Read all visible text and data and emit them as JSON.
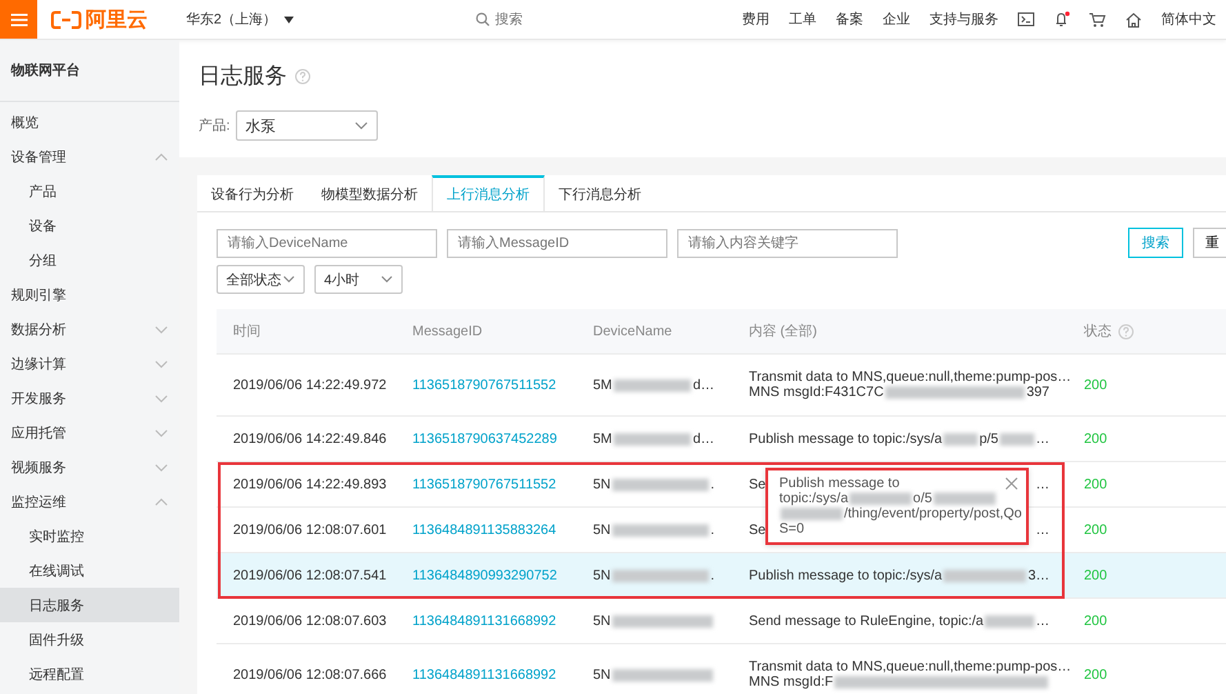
{
  "topbar": {
    "logo": "阿里云",
    "region": "华东2（上海）",
    "search_placeholder": "搜索",
    "links": [
      "费用",
      "工单",
      "备案",
      "企业",
      "支持与服务"
    ],
    "notification_dot": true,
    "language": "简体中文"
  },
  "sidebar": {
    "title": "物联网平台",
    "items": [
      {
        "label": "概览",
        "selected": false
      },
      {
        "label": "设备管理",
        "selected": false,
        "expanded": true,
        "children": [
          {
            "label": "产品",
            "selected": false
          },
          {
            "label": "设备",
            "selected": false
          },
          {
            "label": "分组",
            "selected": false
          }
        ]
      },
      {
        "label": "规则引擎",
        "selected": false
      },
      {
        "label": "数据分析",
        "selected": false,
        "expanded": false
      },
      {
        "label": "边缘计算",
        "selected": false,
        "expanded": false
      },
      {
        "label": "开发服务",
        "selected": false,
        "expanded": false
      },
      {
        "label": "应用托管",
        "selected": false,
        "expanded": false
      },
      {
        "label": "视频服务",
        "selected": false,
        "expanded": false
      },
      {
        "label": "监控运维",
        "selected": false,
        "expanded": true,
        "children": [
          {
            "label": "实时监控",
            "selected": false
          },
          {
            "label": "在线调试",
            "selected": false
          },
          {
            "label": "日志服务",
            "selected": true
          },
          {
            "label": "固件升级",
            "selected": false
          },
          {
            "label": "远程配置",
            "selected": false
          }
        ]
      }
    ]
  },
  "page": {
    "title": "日志服务",
    "product_label": "产品:",
    "product_value": "水泵"
  },
  "tabs": [
    {
      "label": "设备行为分析",
      "selected": false
    },
    {
      "label": "物模型数据分析",
      "selected": false
    },
    {
      "label": "上行消息分析",
      "selected": true
    },
    {
      "label": "下行消息分析",
      "selected": false
    }
  ],
  "filters": {
    "device_placeholder": "请输入DeviceName",
    "message_placeholder": "请输入MessageID",
    "keyword_placeholder": "请输入内容关键字",
    "status": "全部状态",
    "range": "4小时",
    "search_button": "搜索",
    "reset_button": "重"
  },
  "table": {
    "columns": [
      "时间",
      "MessageID",
      "DeviceName",
      "内容 (全部)",
      "状态"
    ],
    "rows": [
      {
        "time": "2019/06/06 14:22:49.972",
        "message_id": "1136518790767511552",
        "device": [
          {
            "kind": "text",
            "text": "5M"
          },
          {
            "kind": "redacted"
          },
          {
            "kind": "text",
            "text": "d…"
          }
        ],
        "content": [
          [
            {
              "kind": "text",
              "text": "Transmit data to MNS,queue:null,theme:pump-pos…"
            }
          ],
          [
            {
              "kind": "text",
              "text": "MNS msgId:F431C7C"
            },
            {
              "kind": "redacted"
            },
            {
              "kind": "text",
              "text": "397"
            }
          ]
        ],
        "status": "200",
        "selected": false,
        "highlighted": false
      },
      {
        "time": "2019/06/06 14:22:49.846",
        "message_id": "1136518790637452289",
        "device": [
          {
            "kind": "text",
            "text": "5M"
          },
          {
            "kind": "redacted"
          },
          {
            "kind": "text",
            "text": "d…"
          }
        ],
        "content": [
          [
            {
              "kind": "text",
              "text": "Publish message to topic:/sys/a"
            },
            {
              "kind": "redacted"
            },
            {
              "kind": "text",
              "text": "p/5"
            },
            {
              "kind": "redacted"
            },
            {
              "kind": "text",
              "text": "…"
            }
          ]
        ],
        "status": "200",
        "selected": false,
        "highlighted": false
      },
      {
        "time": "2019/06/06 14:22:49.893",
        "message_id": "1136518790767511552",
        "device": [
          {
            "kind": "text",
            "text": "5N"
          },
          {
            "kind": "redacted"
          },
          {
            "kind": "text",
            "text": "."
          }
        ],
        "content": [
          [
            {
              "kind": "text",
              "text": "Se"
            },
            {
              "kind": "text",
              "text": "…"
            }
          ]
        ],
        "status": "200",
        "selected": false,
        "highlighted": true
      },
      {
        "time": "2019/06/06 12:08:07.601",
        "message_id": "1136484891135883264",
        "device": [
          {
            "kind": "text",
            "text": "5N"
          },
          {
            "kind": "redacted"
          },
          {
            "kind": "text",
            "text": "."
          }
        ],
        "content": [
          [
            {
              "kind": "text",
              "text": "Se"
            },
            {
              "kind": "text",
              "text": "…"
            }
          ]
        ],
        "status": "200",
        "selected": false,
        "highlighted": true
      },
      {
        "time": "2019/06/06 12:08:07.541",
        "message_id": "1136484890993290752",
        "device": [
          {
            "kind": "text",
            "text": "5N"
          },
          {
            "kind": "redacted"
          },
          {
            "kind": "text",
            "text": "."
          }
        ],
        "content": [
          [
            {
              "kind": "text",
              "text": "Publish message to topic:/sys/a"
            },
            {
              "kind": "redacted"
            },
            {
              "kind": "text",
              "text": "3…"
            }
          ]
        ],
        "status": "200",
        "selected": true,
        "highlighted": true
      },
      {
        "time": "2019/06/06 12:08:07.603",
        "message_id": "1136484891131668992",
        "device": [
          {
            "kind": "text",
            "text": "5N"
          },
          {
            "kind": "redacted"
          }
        ],
        "content": [
          [
            {
              "kind": "text",
              "text": "Send message to RuleEngine, topic:/a"
            },
            {
              "kind": "redacted"
            },
            {
              "kind": "text",
              "text": "…"
            }
          ]
        ],
        "status": "200",
        "selected": false,
        "highlighted": false
      },
      {
        "time": "2019/06/06 12:08:07.666",
        "message_id": "1136484891131668992",
        "device": [
          {
            "kind": "text",
            "text": "5N"
          },
          {
            "kind": "redacted"
          }
        ],
        "content": [
          [
            {
              "kind": "text",
              "text": "Transmit data to MNS,queue:null,theme:pump-pos…"
            }
          ],
          [
            {
              "kind": "text",
              "text": "MNS msgId:F"
            },
            {
              "kind": "redacted"
            }
          ]
        ],
        "status": "200",
        "selected": false,
        "highlighted": false
      }
    ]
  },
  "tooltip": {
    "outlined": true,
    "lines": [
      [
        {
          "kind": "text",
          "text": "Publish message to"
        }
      ],
      [
        {
          "kind": "text",
          "text": "topic:/sys/a"
        },
        {
          "kind": "redacted"
        },
        {
          "kind": "text",
          "text": "o/5"
        },
        {
          "kind": "redacted"
        }
      ],
      [
        {
          "kind": "redacted"
        },
        {
          "kind": "text",
          "text": "/thing/event/property/post,Qo"
        }
      ],
      [
        {
          "kind": "text",
          "text": "S=0"
        }
      ]
    ]
  }
}
